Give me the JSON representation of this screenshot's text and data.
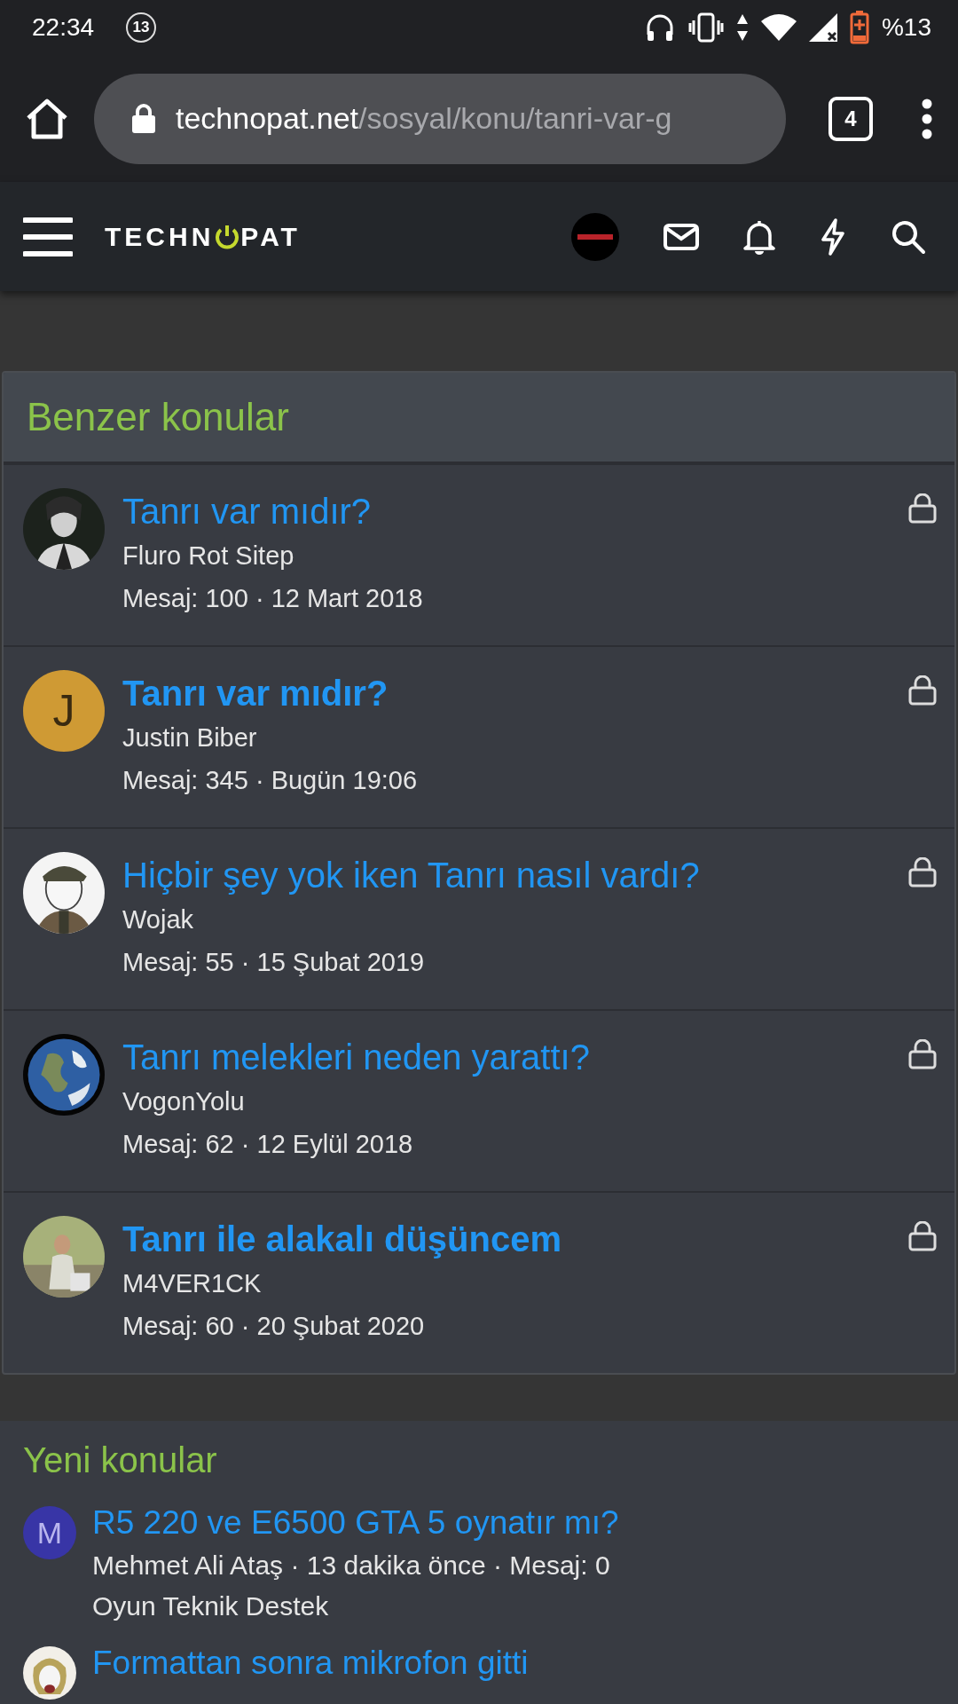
{
  "status_bar": {
    "time": "22:34",
    "notification_count": "13",
    "battery": "%13"
  },
  "browser": {
    "url_domain": "technopat.net",
    "url_path": "/sosyal/konu/tanri-var-g",
    "tab_count": "4"
  },
  "site_header": {
    "logo_start": "TECHN",
    "logo_end": "PAT"
  },
  "similar_threads": {
    "title": "Benzer konular",
    "threads": [
      {
        "title": "Tanrı var mıdır?",
        "author": "Fluro Rot Sitep",
        "meta": "Mesaj: 100 · 12 Mart 2018",
        "unread": false,
        "locked": true
      },
      {
        "title": "Tanrı var mıdır?",
        "author": "Justin Biber",
        "meta": "Mesaj: 345 · Bugün 19:06",
        "unread": true,
        "locked": true,
        "avatar": {
          "kind": "letter",
          "letter": "J",
          "color": "#cf9a34"
        }
      },
      {
        "title": "Hiçbir şey yok iken Tanrı nasıl vardı?",
        "author": "Wojak",
        "meta": "Mesaj: 55 · 15 Şubat 2019",
        "unread": false,
        "locked": true
      },
      {
        "title": "Tanrı melekleri neden yarattı?",
        "author": "VogonYolu",
        "meta": "Mesaj: 62 · 12 Eylül 2018",
        "unread": false,
        "locked": true
      },
      {
        "title": "Tanrı ile alakalı düşüncem",
        "author": "M4VER1CK",
        "meta": "Mesaj: 60 · 20 Şubat 2020",
        "unread": true,
        "locked": true
      }
    ]
  },
  "new_threads": {
    "title": "Yeni konular",
    "threads": [
      {
        "title": "R5 220 ve E6500 GTA 5 oynatır mı?",
        "meta": "Mehmet Ali Ataş · 13 dakika önce · Mesaj: 0",
        "forum": "Oyun Teknik Destek",
        "avatar": {
          "kind": "letter",
          "letter": "M",
          "color": "#3835a6"
        }
      },
      {
        "title": "Formattan sonra mikrofon gitti"
      }
    ]
  }
}
